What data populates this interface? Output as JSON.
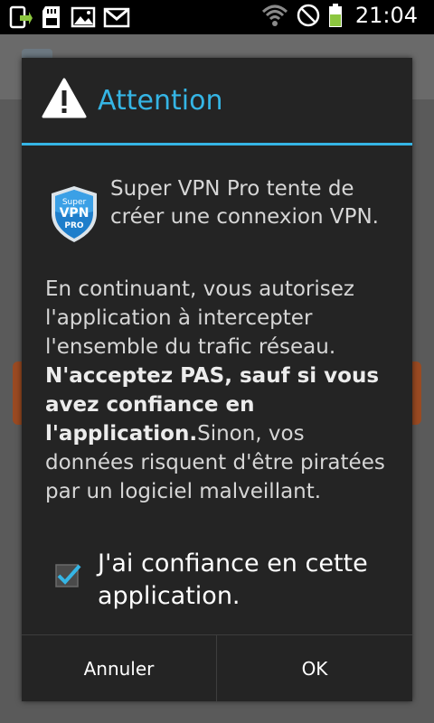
{
  "status_bar": {
    "time": "21:04",
    "left_icons": [
      "app-update-icon",
      "sd-card-icon",
      "gallery-icon",
      "gmail-icon"
    ],
    "right_icons": [
      "wifi-icon",
      "no-signal-icon",
      "battery-icon"
    ],
    "battery_color": "#8cc63f"
  },
  "dialog": {
    "title": "Attention",
    "accent_color": "#35b5e5",
    "logo": {
      "line1": "Super",
      "line2": "VPN",
      "line3": "PRO"
    },
    "message_intro": "Super VPN Pro tente de créer une connexion VPN.",
    "message_part1": "En continuant, vous autorisez l'application à intercepter l'ensemble du trafic réseau. ",
    "message_bold": "N'acceptez PAS, sauf si vous avez confiance en l'application.",
    "message_part2": "Sinon, vos données risquent d'être piratées par un logiciel malveillant.",
    "checkbox": {
      "label": "J'ai confiance en cette application.",
      "checked": true
    },
    "buttons": {
      "cancel": "Annuler",
      "ok": "OK"
    }
  }
}
